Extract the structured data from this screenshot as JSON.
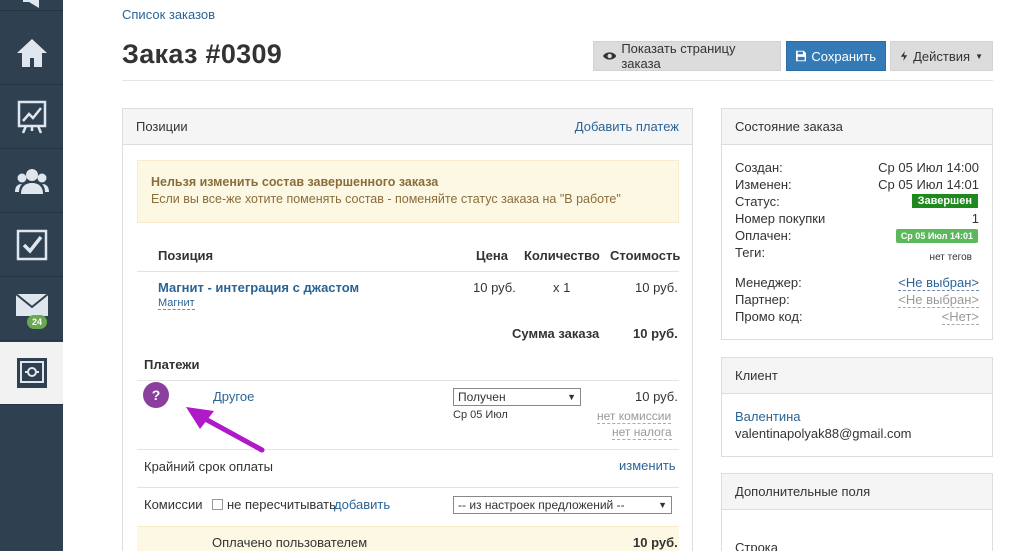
{
  "breadcrumb": "Список заказов",
  "title": "Заказ #0309",
  "actions": {
    "show_page": "Показать страницу заказа",
    "save": "Сохранить",
    "actions": "Действия"
  },
  "sidebar": {
    "items": [
      {
        "icon": "home-icon"
      },
      {
        "icon": "chart-icon"
      },
      {
        "icon": "users-icon"
      },
      {
        "icon": "checkbox-icon"
      },
      {
        "icon": "mail-icon",
        "badge": "24"
      },
      {
        "icon": "safe-icon",
        "active": true
      }
    ]
  },
  "positions_panel": {
    "title": "Позиции",
    "add_payment": "Добавить платеж",
    "alert_title": "Нельзя изменить состав завершенного заказа",
    "alert_text": "Если вы все-же хотите поменять состав - поменяйте статус заказа на \"В работе\"",
    "columns": {
      "item": "Позиция",
      "price": "Цена",
      "qty": "Количество",
      "cost": "Стоимость"
    },
    "row": {
      "name": "Магнит - интеграция с джастом",
      "tag": "Магнит",
      "price": "10 руб.",
      "qty": "x 1",
      "cost": "10 руб."
    },
    "sum_label": "Сумма заказа",
    "sum_value": "10 руб.",
    "payments_title": "Платежи",
    "payment": {
      "name": "Другое",
      "status": "Получен",
      "date": "Ср 05 Июл",
      "amount": "10 руб.",
      "no_commission": "нет комиссии",
      "no_tax": "нет налога"
    },
    "deadline_label": "Крайний срок оплаты",
    "deadline_change": "изменить",
    "commission_label": "Комиссии",
    "no_recalc": "не пересчитывать",
    "add": "добавить",
    "commission_select": "-- из настроек предложений --",
    "paid_by_user": "Оплачено пользователем",
    "paid_value": "10 руб."
  },
  "state_panel": {
    "title": "Состояние заказа",
    "created_label": "Создан:",
    "created_value": "Ср 05 Июл 14:00",
    "changed_label": "Изменен:",
    "changed_value": "Ср 05 Июл 14:01",
    "status_label": "Статус:",
    "status_value": "Завершен",
    "purchase_label": "Номер покупки",
    "purchase_value": "1",
    "paid_label": "Оплачен:",
    "paid_value": "Ср 05 Июл 14:01",
    "tags_label": "Теги:",
    "tags_value": "нет тегов",
    "manager_label": "Менеджер:",
    "manager_value": "<Не выбран>",
    "partner_label": "Партнер:",
    "partner_value": "<Не выбран>",
    "promo_label": "Промо код:",
    "promo_value": "<Нет>"
  },
  "client_panel": {
    "title": "Клиент",
    "name": "Валентина",
    "email": "valentinapolyak88@gmail.com"
  },
  "extra_panel": {
    "title": "Дополнительные поля",
    "row": "Строка"
  },
  "colors": {
    "sidebar": "#2f4050",
    "primary": "#337ab7",
    "link": "#2a6496",
    "status_green": "#1e8a1e",
    "question_purple": "#8a3f9e",
    "arrow_purple": "#b019c8"
  }
}
